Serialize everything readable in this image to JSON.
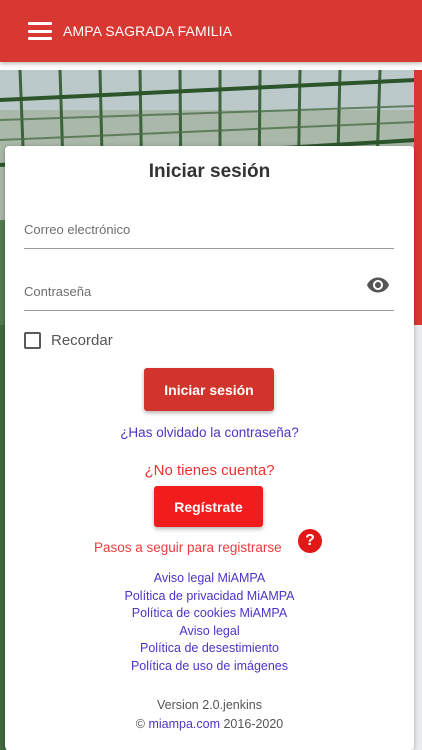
{
  "app_bar": {
    "menu_icon": "hamburger-menu-icon",
    "title": "AMPA SAGRADA FAMILIA",
    "color": "#d93732"
  },
  "login": {
    "title": "Iniciar sesión",
    "email_placeholder": "Correo electrónico",
    "email_value": "",
    "password_placeholder": "Contraseña",
    "password_value": "",
    "show_password_icon": "eye-icon",
    "remember_label": "Recordar",
    "remember_checked": false,
    "login_button": "Iniciar sesión",
    "forgot_password": "¿Has olvidado la contraseña?"
  },
  "register": {
    "no_account": "¿No tienes cuenta?",
    "button": "Regístrate",
    "steps_link": "Pasos a seguir para registrarse",
    "help_icon": "help-icon",
    "help_glyph": "?"
  },
  "legal_links": [
    "Aviso legal MiAMPA",
    "Política de privacidad MiAMPA",
    "Política de cookies MiAMPA",
    "Aviso legal",
    "Política de desestimiento",
    "Política de uso de imágenes"
  ],
  "footer": {
    "version": "Version 2.0.jenkins",
    "copyright_symbol": "©",
    "site_link": "miampa.com",
    "years": "2016-2020"
  },
  "colors": {
    "primary": "#d93732",
    "register_button": "#f21c1c",
    "link": "#4a35c8",
    "accent_text": "#f0302a"
  }
}
